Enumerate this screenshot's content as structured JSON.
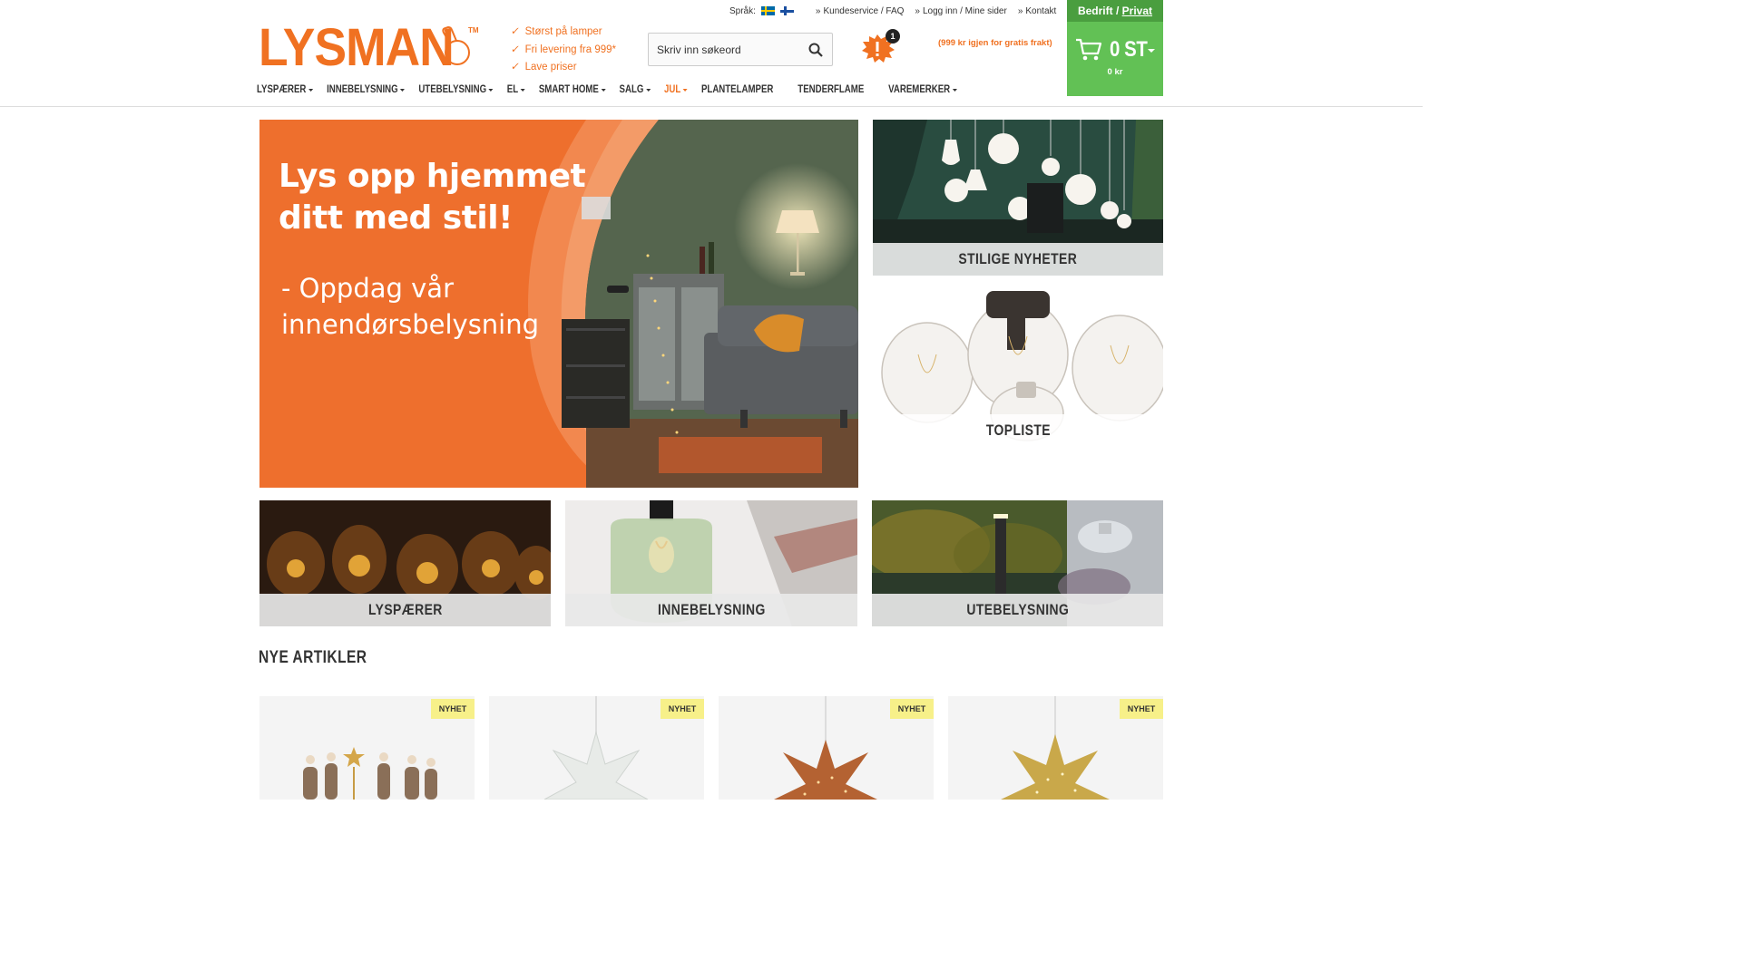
{
  "header": {
    "language_label": "Språk:",
    "top_links": [
      "Kundeservice / FAQ",
      "Logg inn / Mine sider",
      "Kontakt"
    ],
    "logo_text": "LYSMAN",
    "logo_tm": "TM",
    "usps": [
      "Størst på lamper",
      "Fri levering fra 999*",
      "Lave priser"
    ],
    "search_placeholder": "Skriv inn søkeord",
    "alert_count": "1",
    "free_shipping_text": "(999 kr igjen for gratis frakt)",
    "customer_type": {
      "business": "Bedrift",
      "separator": " / ",
      "private": "Privat"
    },
    "cart": {
      "count": "0 ST",
      "total": "0 kr"
    }
  },
  "nav": {
    "items": [
      {
        "label": "LYSPÆRER",
        "dropdown": true
      },
      {
        "label": "INNEBELYSNING",
        "dropdown": true
      },
      {
        "label": "UTEBELYSNING",
        "dropdown": true
      },
      {
        "label": "EL",
        "dropdown": true
      },
      {
        "label": "SMART HOME",
        "dropdown": true
      },
      {
        "label": "SALG",
        "dropdown": true
      },
      {
        "label": "JUL",
        "dropdown": true
      },
      {
        "label": "PLANTELAMPER",
        "dropdown": false
      },
      {
        "label": "TENDERFLAME",
        "dropdown": false
      },
      {
        "label": "VAREMERKER",
        "dropdown": true
      }
    ]
  },
  "hero": {
    "headline_line1": "Lys opp hjemmet",
    "headline_line2": "ditt med stil!",
    "sub_line1": "- Oppdag vår",
    "sub_line2": "innendørsbelysning"
  },
  "side_tiles": {
    "news": "STILIGE NYHETER",
    "toplist": "TOPLISTE"
  },
  "category_tiles": [
    "LYSPÆRER",
    "INNEBELYSNING",
    "UTEBELYSNING"
  ],
  "new_articles": {
    "title": "NYE ARTIKLER",
    "badge": "NYHET"
  },
  "colors": {
    "brand_orange": "#f07121",
    "cart_green": "#62c155",
    "toggle_green": "#4a9e3f",
    "badge_yellow": "#f7f089"
  }
}
